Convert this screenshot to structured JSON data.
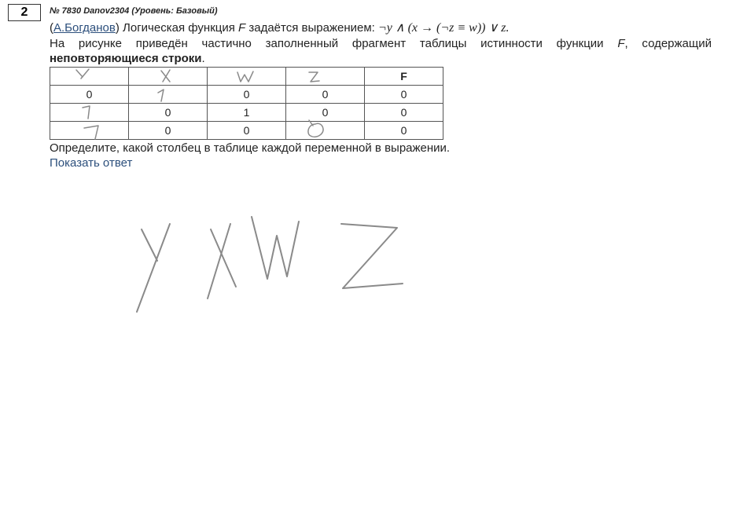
{
  "problem": {
    "number": "2",
    "meta": "№ 7830 Danov2304 (Уровень: Базовый)",
    "open_paren": "(",
    "author": "А.Богданов",
    "intro": ") Логическая функция ",
    "func_name": "F",
    "intro_end": " задаётся выражением: ",
    "expression": "¬y ∧ (x → (¬z ≡ w)) ∨ z.",
    "line2_a": "На рисунке приведён частично заполненный фрагмент таблицы истинности  функции ",
    "line2_f": "F",
    "line2_b": ", содержащий",
    "line3_bold": "неповторяющиеся строки",
    "line3_end": ".",
    "question": "Определите, какой столбец в таблице каждой переменной в выражении.",
    "show_answer": "Показать ответ"
  },
  "table": {
    "header_last": "F",
    "rows": [
      [
        "0",
        "",
        "0",
        "0",
        "0"
      ],
      [
        "",
        "0",
        "1",
        "0",
        "0"
      ],
      [
        "",
        "0",
        "0",
        "",
        "0"
      ]
    ]
  },
  "handwriting": {
    "ink_color": "#8a8a8a",
    "table_header_marks": [
      "Y",
      "X",
      "W",
      "Z"
    ],
    "table_cell_marks": [
      "1",
      "1",
      "1",
      "0"
    ],
    "answer_marks": [
      "Y",
      "X",
      "W",
      "Z"
    ]
  }
}
